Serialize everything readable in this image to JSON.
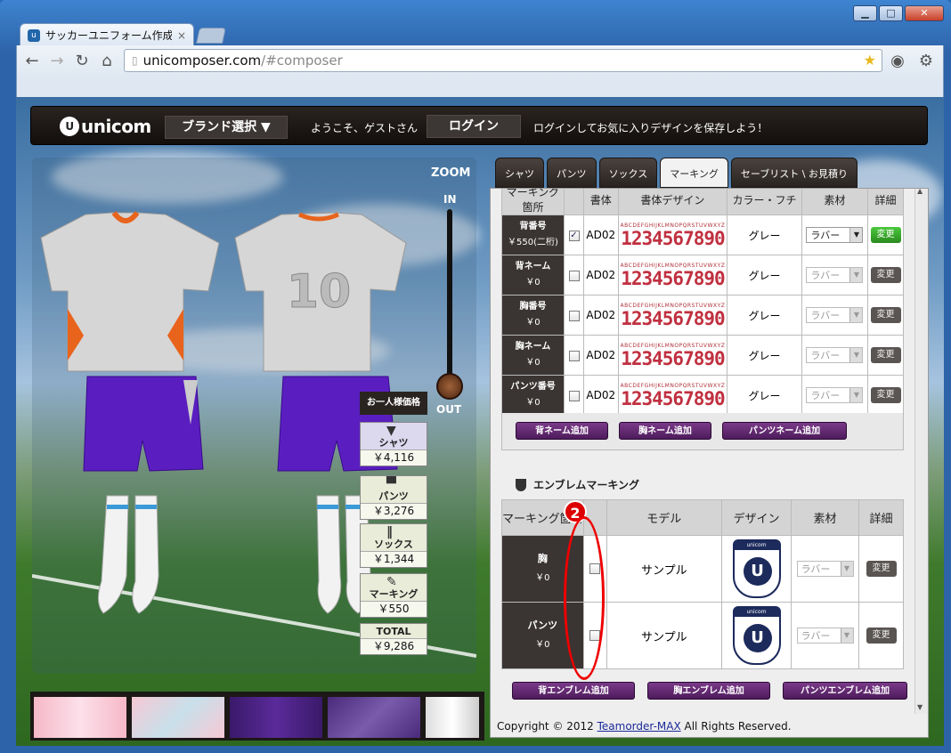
{
  "browser": {
    "tab_title": "サッカーユニフォーム作成",
    "url_host": "unicomposer.com",
    "url_path": "/#composer"
  },
  "header": {
    "brand_select": "ブランド選択 ▼",
    "welcome": "ようこそ、ゲストさん",
    "login": "ログイン",
    "save_msg": "ログインしてお気に入りデザインを保存しよう！",
    "logo": "unicom"
  },
  "zoom": {
    "title": "ZOOM",
    "in": "IN",
    "out": "OUT"
  },
  "prices": {
    "head": "お一人様価格",
    "items": [
      {
        "name": "シャツ",
        "price": "￥4,116"
      },
      {
        "name": "パンツ",
        "price": "￥3,276"
      },
      {
        "name": "ソックス",
        "price": "￥1,344"
      },
      {
        "name": "マーキング",
        "price": "￥550"
      },
      {
        "name": "TOTAL",
        "price": "￥9,286"
      }
    ]
  },
  "jersey_number": "10",
  "tabs": [
    "シャツ",
    "パンツ",
    "ソックス",
    "マーキング",
    "セーブリスト \\ お見積り"
  ],
  "marking": {
    "headers": [
      "マーキング箇所",
      "書体",
      "書体デザイン",
      "カラー・フチ",
      "素材",
      "詳細"
    ],
    "rows": [
      {
        "label": "背番号",
        "price": "￥550(二桁)",
        "checked": "✓",
        "font": "AD02",
        "color": "グレー",
        "material": "ラバー",
        "detail": "変更"
      },
      {
        "label": "背ネーム",
        "price": "￥0",
        "checked": "",
        "font": "AD02",
        "color": "グレー",
        "material": "ラバー",
        "detail": "変更"
      },
      {
        "label": "胸番号",
        "price": "￥0",
        "checked": "",
        "font": "AD02",
        "color": "グレー",
        "material": "ラバー",
        "detail": "変更"
      },
      {
        "label": "胸ネーム",
        "price": "￥0",
        "checked": "",
        "font": "AD02",
        "color": "グレー",
        "material": "ラバー",
        "detail": "変更"
      },
      {
        "label": "パンツ番号",
        "price": "￥0",
        "checked": "",
        "font": "AD02",
        "color": "グレー",
        "material": "ラバー",
        "detail": "変更"
      }
    ],
    "font_sample_small": "ABCDEFGHIJKLMNOPQRSTUVWXYZ",
    "font_sample_big": "1234567890",
    "add_buttons": [
      "背ネーム追加",
      "胸ネーム追加",
      "パンツネーム追加"
    ]
  },
  "emblem": {
    "title": "エンブレムマーキング",
    "headers": [
      "マーキング箇所",
      "",
      "モデル",
      "デザイン",
      "素材",
      "詳細"
    ],
    "rows": [
      {
        "label": "胸",
        "price": "￥0",
        "model": "サンプル",
        "material": "ラバー",
        "detail": "変更"
      },
      {
        "label": "パンツ",
        "price": "￥0",
        "model": "サンプル",
        "material": "ラバー",
        "detail": "変更"
      }
    ],
    "emblem_text": "unicom",
    "emblem_letter": "U",
    "add_buttons": [
      "背エンブレム追加",
      "胸エンブレム追加",
      "パンツエンブレム追加"
    ]
  },
  "annotation": "2",
  "footer": {
    "prefix": "Copyright © 2012 ",
    "link": "Teamorder-MAX",
    "suffix": " All Rights Reserved."
  }
}
